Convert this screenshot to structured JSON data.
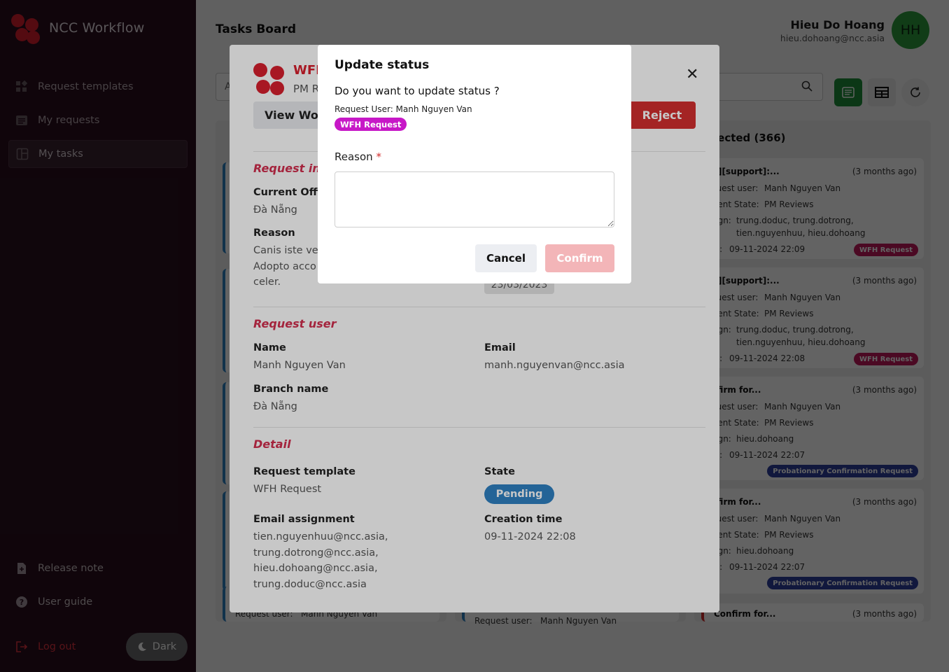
{
  "app": {
    "name": "NCC Workflow"
  },
  "sidebar": {
    "items": [
      {
        "label": "Request templates",
        "icon": "grid-icon"
      },
      {
        "label": "My requests",
        "icon": "list-icon"
      },
      {
        "label": "My tasks",
        "icon": "board-icon",
        "active": true
      }
    ],
    "release_note": "Release note",
    "user_guide": "User guide",
    "logout": "Log out",
    "theme_toggle": "Dark"
  },
  "header": {
    "page_title": "Tasks Board",
    "user_name": "Hieu Do Hoang",
    "user_email": "hieu.dohoang@ncc.asia",
    "avatar_initials": "HH"
  },
  "board": {
    "rejected_column": {
      "title": "jected (366)",
      "cards": [
        {
          "title": "N][support]:...",
          "time": "(3 months ago)",
          "user_key": "quest user:",
          "user": "Manh Nguyen Van",
          "state_key": "rrent State:",
          "state": "PM Reviews",
          "assign_key": "sign:",
          "assign": "trung.doduc, trung.dotrong,",
          "assign2": "tien.nguyenhuu, hieu.dohoang",
          "date_key": "te:",
          "date": "09-11-2024 22:09",
          "tag": "WFH Request"
        },
        {
          "title": "N][support]:...",
          "time": "(3 months ago)",
          "user_key": "quest user:",
          "user": "Manh Nguyen Van",
          "state_key": "rrent State:",
          "state": "PM Reviews",
          "assign_key": "sign:",
          "assign": "trung.doduc, trung.dotrong,",
          "assign2": "tien.nguyenhuu, hieu.dohoang",
          "date_key": "te:",
          "date": "09-11-2024 22:08",
          "tag": "WFH Request"
        },
        {
          "title": "nfirm for...",
          "time": "(3 months ago)",
          "user_key": "quest user:",
          "user": "Manh Nguyen Van",
          "state_key": "rrent State:",
          "state": "PM Reviews",
          "assign_key": "sign:",
          "assign": "hieu.dohoang",
          "date_key": "te:",
          "date": "09-11-2024 22:07",
          "tag": "Probationary Confirmation Request"
        },
        {
          "title": "nfirm for...",
          "time": "(3 months ago)",
          "user_key": "quest user:",
          "user": "Manh Nguyen Van",
          "state_key": "rrent State:",
          "state": "PM Reviews",
          "assign_key": "sign:",
          "assign": "hieu.dohoang",
          "date_key": "te:",
          "date": "09-11-2024 22:07",
          "tag": "Probationary Confirmation Request"
        },
        {
          "title": "Confirm for...",
          "time": "(3 months ago)"
        }
      ]
    },
    "col1_cutoff": {
      "key": "Request user:",
      "value": "Manh Nguyen Van"
    },
    "col2_cutoff": {
      "key": "Request user:",
      "value": "Manh Nguyen Van"
    },
    "search_placeholder_fragment": "A"
  },
  "detail": {
    "title": "WFH",
    "subtitle": "PM R",
    "view_work_button": "View Wor",
    "reject_button": "Reject",
    "request_info_title": "Request inf",
    "current_office_label": "Current Offi",
    "current_office_value": "Đà Nẵng",
    "reason_label": "Reason",
    "reason_line1": "Canis iste ve",
    "reason_line2": "Adopto acco",
    "reason_line3": "celer.",
    "hidden_date": "23/03/2023",
    "request_user_title": "Request user",
    "name_label": "Name",
    "name_value": "Manh Nguyen Van",
    "email_label": "Email",
    "email_value": "manh.nguyenvan@ncc.asia",
    "branch_label": "Branch name",
    "branch_value": "Đà Nẵng",
    "detail_title": "Detail",
    "template_label": "Request template",
    "template_value": "WFH Request",
    "state_label": "State",
    "state_value": "Pending",
    "assign_label": "Email assignment",
    "assign_1": "tien.nguyenhuu@ncc.asia,",
    "assign_2": "trung.dotrong@ncc.asia,",
    "assign_3": "hieu.dohoang@ncc.asia,",
    "assign_4": "trung.doduc@ncc.asia",
    "creation_label": "Creation time",
    "creation_value": "09-11-2024 22:08"
  },
  "dialog": {
    "title": "Update status",
    "question": "Do you want to update status ?",
    "request_user": "Request User: Manh Nguyen Van",
    "tag": "WFH Request",
    "reason_label": "Reason",
    "required_mark": "*",
    "reason_value": "",
    "cancel": "Cancel",
    "confirm": "Confirm"
  },
  "colors": {
    "brand_red": "#d81f2e",
    "sidebar_bg": "#2a0f1f",
    "pending_blue": "#2f80c2",
    "wfh_tag": "#c718c7",
    "confirm_disabled": "#f3b5b8",
    "avatar_green": "#2c9a3c"
  }
}
